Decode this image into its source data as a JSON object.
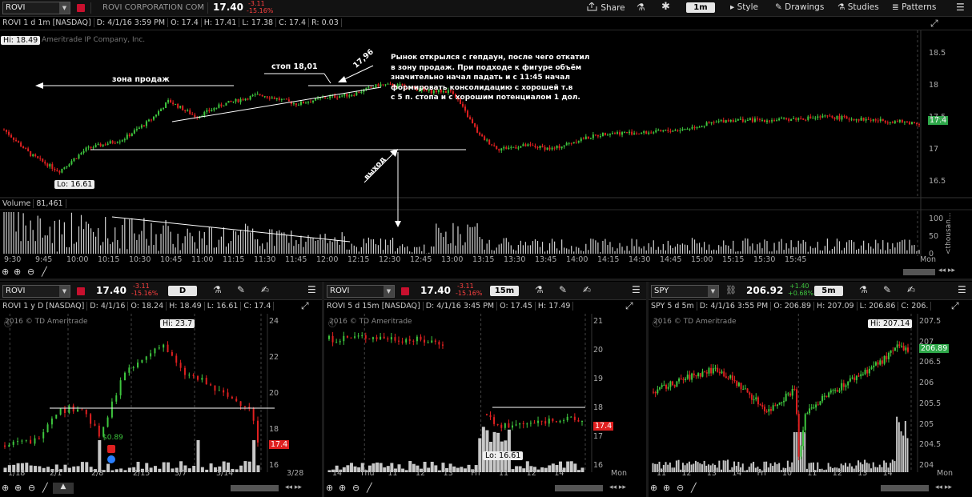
{
  "top": {
    "symbol": "ROVI",
    "company": "ROVI CORPORATION COM",
    "price": "17.40",
    "change": "-3.11",
    "change_pct": "-15.16%",
    "share": "Share",
    "timeframe": "1m",
    "style": "Style",
    "drawings": "Drawings",
    "studies": "Studies",
    "patterns": "Patterns"
  },
  "main": {
    "title": "ROVI 1 d 1m [NASDAQ]",
    "d": "D: 4/1/16 3:59 PM",
    "o": "O: 17.4",
    "h": "H: 17.41",
    "l": "L: 17.38",
    "c": "C: 17.4",
    "r": "R: 0.03",
    "watermark": "Ameritrade IP Company, Inc.",
    "hi": "Hi: 18.49",
    "lo": "Lo: 16.61",
    "last": "17.4",
    "yticks": [
      "18.5",
      "18",
      "17.5",
      "17",
      "16.5"
    ],
    "annot_zone": "зона продаж",
    "annot_stop": "стоп 18,01",
    "annot_1796": "17,96",
    "annot_exit": "выход",
    "annot_text": [
      "Рынок открылся с гепдаун, после чего откатил",
      "в зону продаж. При подходе к фигуре объём",
      "значительно начал падать и с 11:45 начал",
      "формировать консолидацию с хорошей т.в",
      "с 5 п.  стопа и с хорошим потенциалом 1 дол."
    ],
    "vol_label": "Volume",
    "vol_value": "81,461",
    "vol_ticks": [
      "100",
      "50",
      "0"
    ],
    "vol_unit": "<thousan...",
    "xticks": [
      "9:30",
      "9:45",
      "10:00",
      "10:15",
      "10:30",
      "10:45",
      "11:00",
      "11:15",
      "11:30",
      "11:45",
      "12:00",
      "12:15",
      "12:30",
      "12:45",
      "13:00",
      "13:15",
      "13:30",
      "13:45",
      "14:00",
      "14:15",
      "14:30",
      "14:45",
      "15:00",
      "15:15",
      "15:30",
      "15:45",
      "Mon"
    ]
  },
  "panels": [
    {
      "symbol": "ROVI",
      "price": "17.40",
      "change": "-3.11",
      "change_pct": "-15.16%",
      "tf": "D",
      "title": "ROVI 1 y D [NASDAQ]",
      "d": "D: 4/1/16",
      "o": "O: 18.24",
      "h": "H: 18.49",
      "l": "L: 16.61",
      "c": "C: 17.4",
      "watermark": "2016 © TD Ameritrade",
      "hi": "Hi: 23.7",
      "lo": "",
      "last": "17.4",
      "note": "$0.89",
      "yticks": [
        "24",
        "22",
        "20",
        "18",
        "16"
      ],
      "xticks": [
        "1/18",
        "2/1",
        "2/8",
        "2/15",
        "3/7",
        "3/14",
        "3/28"
      ]
    },
    {
      "symbol": "ROVI",
      "price": "17.40",
      "change": "-3.11",
      "change_pct": "-15.16%",
      "tf": "15m",
      "title": "ROVI 5 d 15m [NASDAQ]",
      "d": "D: 4/1/16 3:45 PM",
      "o": "O: 17.45",
      "h": "H: 17.49",
      "l": "",
      "c": "",
      "watermark": "2016 © TD Ameritrade",
      "hi": "",
      "lo": "Lo: 16.61",
      "last": "17.4",
      "note": "",
      "yticks": [
        "21",
        "20",
        "19",
        "18",
        "17",
        "16"
      ],
      "xticks": [
        "14",
        "Thu",
        "11",
        "12",
        "13",
        "Fri",
        "11",
        "12",
        "14",
        "Mon"
      ]
    },
    {
      "symbol": "SPY",
      "price": "206.92",
      "change": "+1.40",
      "change_pct": "+0.68%",
      "tf": "5m",
      "title": "SPY 5 d 5m",
      "d": "D: 4/1/16 3:55 PM",
      "o": "O: 206.89",
      "h": "H: 207.09",
      "l": "L: 206.86",
      "c": "C: 206.",
      "watermark": "2016 © TD Ameritrade",
      "hi": "Hi: 207.14",
      "lo": "",
      "last": "206.89",
      "note": "",
      "yticks": [
        "207.5",
        "207",
        "206.5",
        "206",
        "205.5",
        "205",
        "204.5",
        "204"
      ],
      "xticks": [
        "11",
        "12",
        "13",
        "14",
        "Fri",
        "10",
        "11",
        "12",
        "13",
        "14",
        "Mon"
      ]
    }
  ],
  "colors": {
    "up": "#3ec63e",
    "down": "#e02020",
    "accent": "#2ea84a",
    "bg": "#000000",
    "grid": "#2b2b2b"
  }
}
